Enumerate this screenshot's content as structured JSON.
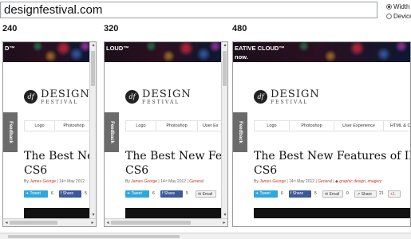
{
  "address_bar": {
    "value": "designfestival.com"
  },
  "mode_options": [
    {
      "label": "Width c",
      "selected": true
    },
    {
      "label": "Device",
      "selected": false
    }
  ],
  "frames": [
    {
      "width_label": "240",
      "banner_line1": "D™",
      "banner_line2": "",
      "nav_items": [
        "Logo",
        "Photoshop"
      ],
      "title_line1": "The Best New",
      "title_line2": "CS6",
      "meta_prefix": "By",
      "meta_author": "James George",
      "meta_date": "14ᵗʰ May 2012",
      "meta_category": "",
      "meta_tags": "",
      "tweet_label": "Tweet",
      "tweet_count": "6",
      "fb_label": "Share",
      "fb_count": "5",
      "email_label": "",
      "email_count": "",
      "share_label": "",
      "share_count": "",
      "gplus_label": ""
    },
    {
      "width_label": "320",
      "banner_line1": "LOUD™",
      "banner_line2": "",
      "nav_items": [
        "Logo",
        "Photoshop",
        "User Ex"
      ],
      "title_line1": "The Best New Featur",
      "title_line2": "CS6",
      "meta_prefix": "By",
      "meta_author": "James George",
      "meta_date": "14ᵗʰ May 2012",
      "meta_category": "General",
      "meta_tags": "",
      "tweet_label": "Tweet",
      "tweet_count": "6",
      "fb_label": "Share",
      "fb_count": "5",
      "email_label": "Email",
      "email_count": "",
      "share_label": "",
      "share_count": "",
      "gplus_label": ""
    },
    {
      "width_label": "480",
      "banner_line1": "EATIVE CLOUD™",
      "banner_line2": "now.",
      "nav_items": [
        "Logo",
        "Photoshop",
        "User Experience",
        "HTML & CS"
      ],
      "title_line1": "The Best New Features of Illustrat",
      "title_line2": "CS6",
      "meta_prefix": "By",
      "meta_author": "James George",
      "meta_date": "14ᵗʰ May 2012",
      "meta_category": "General",
      "meta_tags": "graphic design, imagery",
      "tweet_label": "Tweet",
      "tweet_count": "6",
      "fb_label": "Share",
      "fb_count": "5",
      "email_label": "Email",
      "email_count": "0",
      "share_label": "Share",
      "share_count": "21",
      "gplus_label": "+1"
    }
  ],
  "site": {
    "logo_mark": "df",
    "logo_word": "DESIGN",
    "logo_sub": "FESTIVAL",
    "feedback_label": "Feedback"
  },
  "icons": {
    "scroll_up": "▴",
    "scroll_down": "▾",
    "scroll_left": "◂",
    "scroll_right": "▸"
  },
  "colors": {
    "tweet": "#2fa7da",
    "facebook": "#3b5998",
    "meta_link": "#c0392b",
    "feedback_tab": "#6b6b6b"
  }
}
